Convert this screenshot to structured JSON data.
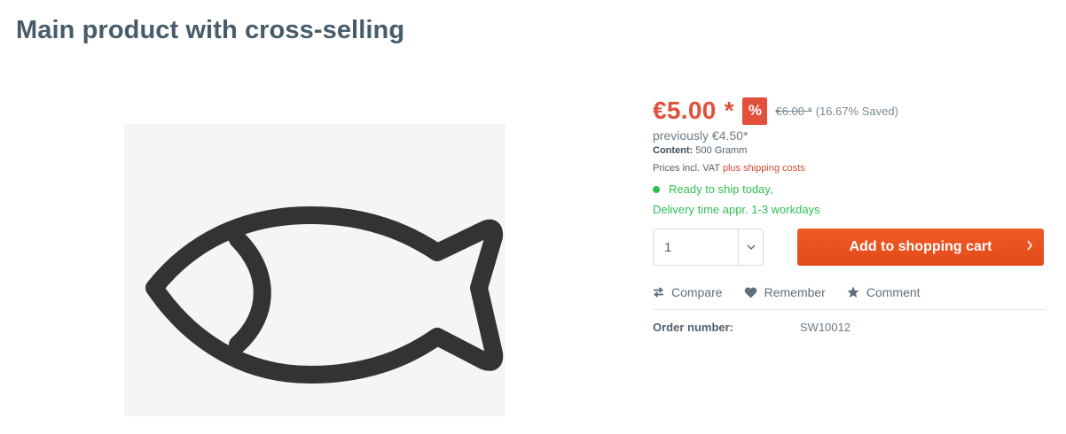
{
  "product": {
    "title": "Main product with cross-selling"
  },
  "price": {
    "current": "€5.00",
    "star": "*",
    "discount_badge": "%",
    "old_price": "€6.00 *",
    "saved": "(16.67% Saved)",
    "previously": "previously €4.50*",
    "content_label": "Content:",
    "content_value": "500 Gramm",
    "vat_text": "Prices incl. VAT",
    "shipping_link": "plus shipping costs"
  },
  "availability": {
    "status": "Ready to ship today,",
    "delivery": "Delivery time appr. 1-3 workdays",
    "color": "#2ebf52"
  },
  "cart": {
    "quantity": "1",
    "add_label": "Add to shopping cart",
    "accent": "#e34a1a"
  },
  "actions": {
    "compare": "Compare",
    "remember": "Remember",
    "comment": "Comment"
  },
  "order": {
    "label": "Order number:",
    "value": "SW10012"
  },
  "icons": {
    "compare": "arrows-exchange-icon",
    "remember": "heart-icon",
    "comment": "star-icon",
    "quantity": "chevron-down-icon",
    "cart": "chevron-right-icon",
    "product_image": "fish-icon"
  }
}
